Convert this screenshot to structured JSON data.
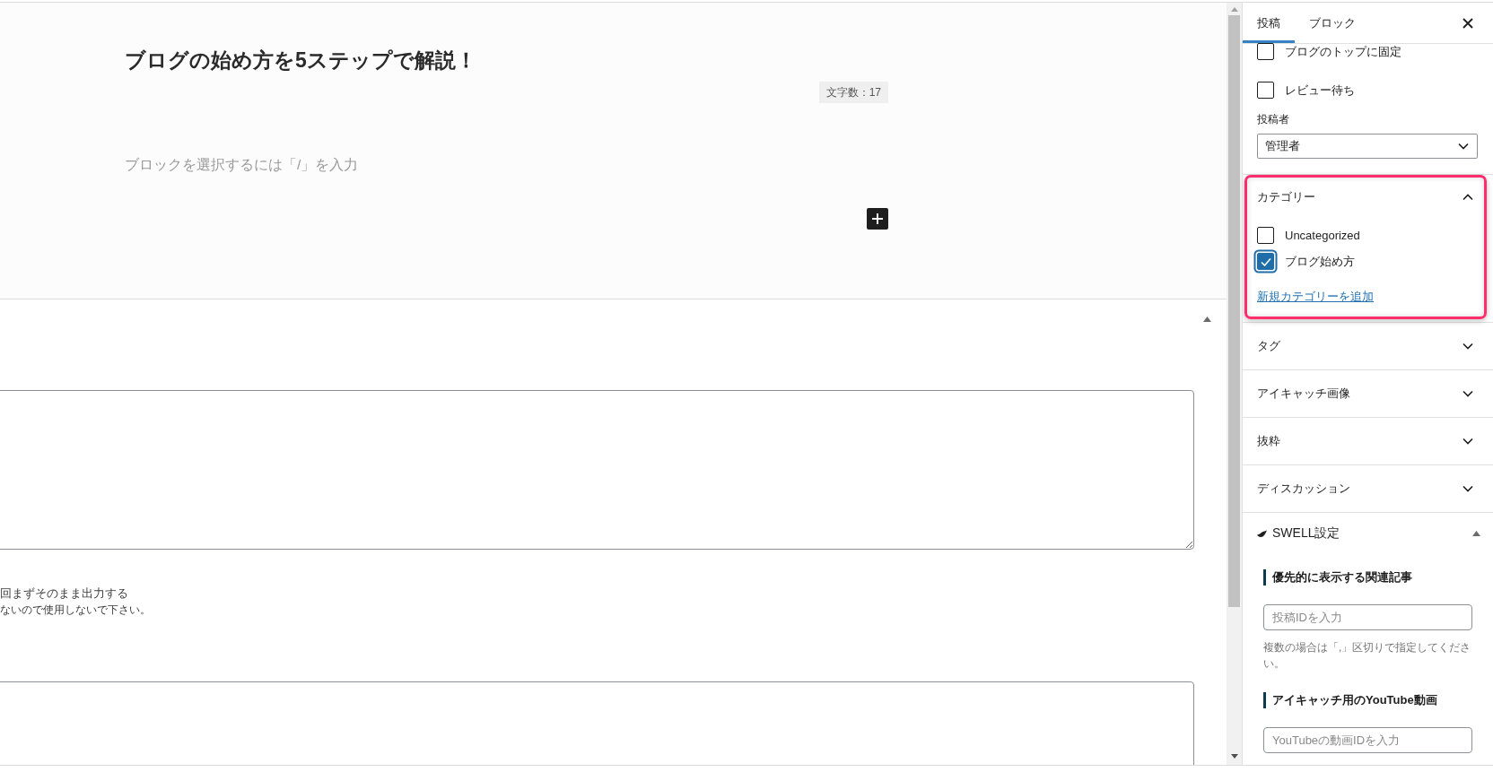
{
  "editor": {
    "title": "ブログの始め方を5ステップで解説！",
    "char_count": "文字数：17",
    "block_placeholder": "ブロックを選択するには「/」を入力"
  },
  "meta_box": {
    "expanded": true,
    "note_line_1": "回まずそのまま出力する",
    "note_line_2": "ないので使用しないで下さい。"
  },
  "sidebar": {
    "tabs": [
      {
        "label": "投稿",
        "selected": true
      },
      {
        "label": "ブロック",
        "selected": false
      }
    ],
    "post_options": [
      {
        "label": "ブログのトップに固定",
        "checked": false
      },
      {
        "label": "レビュー待ち",
        "checked": false
      }
    ],
    "author": {
      "label": "投稿者",
      "value": "管理者"
    },
    "categories": {
      "title": "カテゴリー",
      "expanded": true,
      "highlighted": true,
      "items": [
        {
          "label": "Uncategorized",
          "checked": false
        },
        {
          "label": "ブログ始め方",
          "checked": true
        }
      ],
      "add_link": "新規カテゴリーを追加"
    },
    "panels": [
      {
        "title": "タグ",
        "expanded": false
      },
      {
        "title": "アイキャッチ画像",
        "expanded": false
      },
      {
        "title": "抜粋",
        "expanded": false
      },
      {
        "title": "ディスカッション",
        "expanded": false
      }
    ],
    "swell_settings": {
      "title": "SWELL設定",
      "expanded": true,
      "fields": [
        {
          "heading": "優先的に表示する関連記事",
          "placeholder": "投稿IDを入力",
          "help": "複数の場合は「,」区切りで指定してください。"
        },
        {
          "heading": "アイキャッチ用のYouTube動画",
          "placeholder": "YouTubeの動画IDを入力"
        }
      ]
    }
  }
}
